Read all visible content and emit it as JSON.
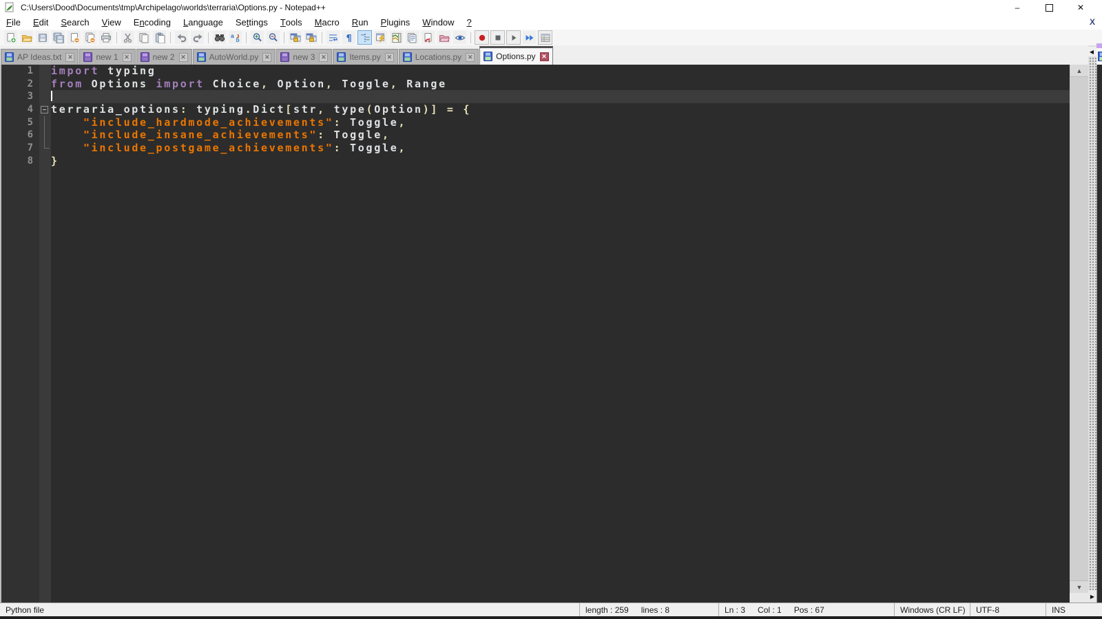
{
  "window": {
    "title": "C:\\Users\\Dood\\Documents\\tmp\\Archipelago\\worlds\\terraria\\Options.py - Notepad++",
    "controls": {
      "minimize": "–",
      "restore": "restore",
      "close": "✕"
    },
    "mdi_close": "X"
  },
  "menu": {
    "items": [
      {
        "label": "File",
        "mnemonic": "F"
      },
      {
        "label": "Edit",
        "mnemonic": "E"
      },
      {
        "label": "Search",
        "mnemonic": "S"
      },
      {
        "label": "View",
        "mnemonic": "V"
      },
      {
        "label": "Encoding",
        "mnemonic": "n"
      },
      {
        "label": "Language",
        "mnemonic": "L"
      },
      {
        "label": "Settings",
        "mnemonic": "t"
      },
      {
        "label": "Tools",
        "mnemonic": "T"
      },
      {
        "label": "Macro",
        "mnemonic": "M"
      },
      {
        "label": "Run",
        "mnemonic": "R"
      },
      {
        "label": "Plugins",
        "mnemonic": "P"
      },
      {
        "label": "Window",
        "mnemonic": "W"
      },
      {
        "label": "?",
        "mnemonic": "?"
      }
    ]
  },
  "toolbar": {
    "groups": [
      [
        {
          "name": "new-file"
        },
        {
          "name": "open-file"
        },
        {
          "name": "save-file"
        },
        {
          "name": "save-all"
        },
        {
          "name": "close-file"
        },
        {
          "name": "close-all"
        },
        {
          "name": "print"
        }
      ],
      [
        {
          "name": "cut"
        },
        {
          "name": "copy"
        },
        {
          "name": "paste"
        }
      ],
      [
        {
          "name": "undo"
        },
        {
          "name": "redo"
        }
      ],
      [
        {
          "name": "find"
        },
        {
          "name": "replace"
        }
      ],
      [
        {
          "name": "zoom-in"
        },
        {
          "name": "zoom-out"
        }
      ],
      [
        {
          "name": "sync-vertical-scroll"
        },
        {
          "name": "sync-horizontal-scroll"
        }
      ],
      [
        {
          "name": "word-wrap"
        },
        {
          "name": "show-all-characters"
        },
        {
          "name": "show-indent-guide",
          "active": true
        },
        {
          "name": "define-language"
        },
        {
          "name": "document-map"
        },
        {
          "name": "document-list"
        },
        {
          "name": "function-list"
        },
        {
          "name": "folder-as-workspace"
        },
        {
          "name": "monitoring"
        }
      ],
      [
        {
          "name": "macro-record",
          "framed": true
        },
        {
          "name": "macro-stop",
          "framed": true
        },
        {
          "name": "macro-play",
          "framed": true
        },
        {
          "name": "macro-run-multiple"
        },
        {
          "name": "macro-save",
          "framed": true
        }
      ]
    ]
  },
  "tabs": [
    {
      "label": "AP Ideas.txt",
      "state": "saved",
      "active": false
    },
    {
      "label": "new 1",
      "state": "edited",
      "active": false
    },
    {
      "label": "new 2",
      "state": "edited",
      "active": false
    },
    {
      "label": "AutoWorld.py",
      "state": "saved",
      "active": false
    },
    {
      "label": "new 3",
      "state": "edited",
      "active": false
    },
    {
      "label": "Items.py",
      "state": "saved",
      "active": false
    },
    {
      "label": "Locations.py",
      "state": "saved",
      "active": false
    },
    {
      "label": "Options.py",
      "state": "saved",
      "active": true
    }
  ],
  "editor": {
    "caret": {
      "line": 3,
      "col": 1
    },
    "current_line": 3,
    "lines": [
      {
        "num": 1,
        "fold": "",
        "segments": [
          {
            "c": "k",
            "t": "import"
          },
          {
            "c": "d",
            "t": " typing"
          }
        ]
      },
      {
        "num": 2,
        "fold": "",
        "segments": [
          {
            "c": "k",
            "t": "from"
          },
          {
            "c": "d",
            "t": " Options "
          },
          {
            "c": "k",
            "t": "import"
          },
          {
            "c": "d",
            "t": " Choice"
          },
          {
            "c": "o",
            "t": ","
          },
          {
            "c": "d",
            "t": " Option"
          },
          {
            "c": "o",
            "t": ","
          },
          {
            "c": "d",
            "t": " Toggle"
          },
          {
            "c": "o",
            "t": ","
          },
          {
            "c": "d",
            "t": " Range"
          }
        ]
      },
      {
        "num": 3,
        "fold": "",
        "segments": []
      },
      {
        "num": 4,
        "fold": "start",
        "segments": [
          {
            "c": "d",
            "t": "terraria_options"
          },
          {
            "c": "o",
            "t": ":"
          },
          {
            "c": "d",
            "t": " typing"
          },
          {
            "c": "o",
            "t": "."
          },
          {
            "c": "d",
            "t": "Dict"
          },
          {
            "c": "o",
            "t": "["
          },
          {
            "c": "d",
            "t": "str"
          },
          {
            "c": "o",
            "t": ","
          },
          {
            "c": "d",
            "t": " type"
          },
          {
            "c": "o",
            "t": "("
          },
          {
            "c": "d",
            "t": "Option"
          },
          {
            "c": "o",
            "t": ")]"
          },
          {
            "c": "d",
            "t": " "
          },
          {
            "c": "o",
            "t": "="
          },
          {
            "c": "d",
            "t": " "
          },
          {
            "c": "o",
            "t": "{"
          }
        ]
      },
      {
        "num": 5,
        "fold": "line",
        "segments": [
          {
            "c": "d",
            "t": "    "
          },
          {
            "c": "s",
            "t": "\"include_hardmode_achievements\""
          },
          {
            "c": "o",
            "t": ":"
          },
          {
            "c": "d",
            "t": " Toggle"
          },
          {
            "c": "o",
            "t": ","
          }
        ]
      },
      {
        "num": 6,
        "fold": "line",
        "segments": [
          {
            "c": "d",
            "t": "    "
          },
          {
            "c": "s",
            "t": "\"include_insane_achievements\""
          },
          {
            "c": "o",
            "t": ":"
          },
          {
            "c": "d",
            "t": " Toggle"
          },
          {
            "c": "o",
            "t": ","
          }
        ]
      },
      {
        "num": 7,
        "fold": "end",
        "segments": [
          {
            "c": "d",
            "t": "    "
          },
          {
            "c": "s",
            "t": "\"include_postgame_achievements\""
          },
          {
            "c": "o",
            "t": ":"
          },
          {
            "c": "d",
            "t": " Toggle"
          },
          {
            "c": "o",
            "t": ","
          }
        ]
      },
      {
        "num": 8,
        "fold": "",
        "segments": [
          {
            "c": "o",
            "t": "}"
          }
        ]
      }
    ]
  },
  "status_bar": {
    "doc_type": "Python file",
    "length_label": "length : 259",
    "lines_label": "lines : 8",
    "ln": "Ln : 3",
    "col": "Col : 1",
    "pos": "Pos : 67",
    "eol": "Windows (CR LF)",
    "encoding": "UTF-8",
    "mode": "INS"
  },
  "colors": {
    "editor_background": "#2c2c2c",
    "current_line": "#3c3c3c",
    "keyword": "#a57fbd",
    "string": "#ec7600",
    "operator": "#e8e2b7",
    "default_text": "#e0e2e4",
    "line_number": "#8f8f8f",
    "saved_tab_icon": "#3e64ce",
    "edited_tab_icon": "#7a55b8",
    "active_tab_close": "#b24f63",
    "indent_guide_active_bg": "#cbe3f7"
  }
}
